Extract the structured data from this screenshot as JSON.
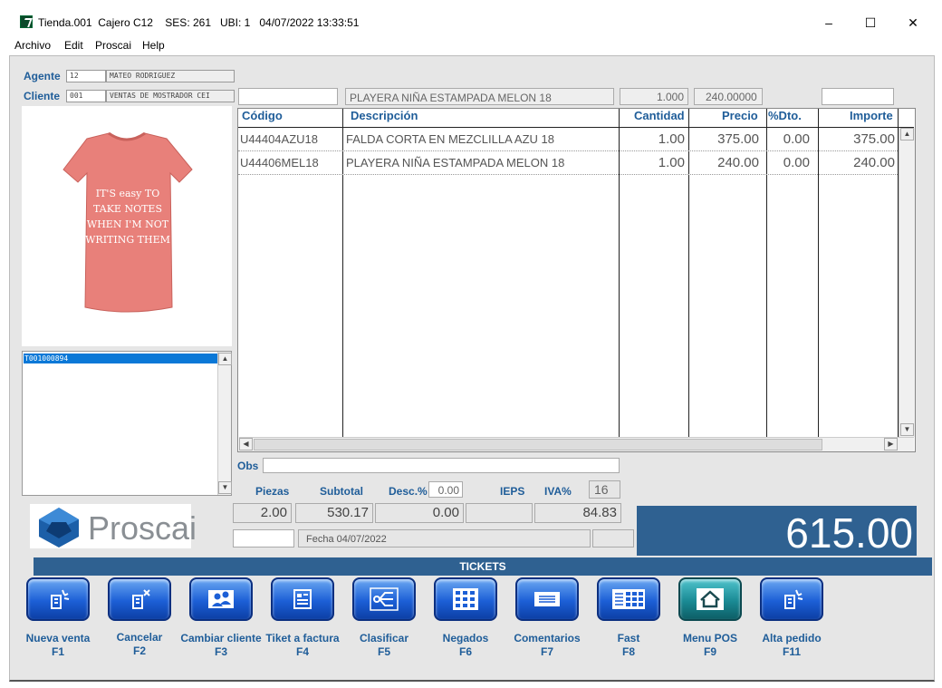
{
  "window": {
    "title": "Tienda.001  Cajero C12    SES: 261   UBI: 1   04/07/2022 13:33:51",
    "minimize": "–",
    "maximize": "☐",
    "close": "✕"
  },
  "menu": [
    "Archivo",
    "Edit",
    "Proscai",
    "Help"
  ],
  "agent": {
    "label": "Agente",
    "code": "12",
    "name": "MATEO RODRIGUEZ"
  },
  "client": {
    "label": "Cliente",
    "code": "001",
    "name": "VENTAS DE MOSTRADOR CEI"
  },
  "product_image": {
    "text_lines": [
      "IT'S easy TO",
      "TAKE NOTES",
      "WHEN I'M NOT",
      "WRITING THEM"
    ],
    "color": "#e8807a"
  },
  "ticket_list": {
    "selected": "T001000894"
  },
  "entry": {
    "code": "",
    "description": "PLAYERA NIÑA ESTAMPADA MELON 18",
    "quantity": "1.000",
    "price": "240.00000",
    "extra": ""
  },
  "table": {
    "headers": [
      "Código",
      "Descripción",
      "Cantidad",
      "Precio",
      "%Dto.",
      "Importe"
    ],
    "rows": [
      [
        "U44404AZU18",
        "FALDA CORTA EN MEZCLILLA AZU 18",
        "1.00",
        "375.00",
        "0.00",
        "375.00"
      ],
      [
        "U44406MEL18",
        "PLAYERA NIÑA ESTAMPADA MELON 18",
        "1.00",
        "240.00",
        "0.00",
        "240.00"
      ]
    ]
  },
  "obs": {
    "label": "Obs",
    "value": ""
  },
  "totals": {
    "piezas_label": "Piezas",
    "piezas": "2.00",
    "subtotal_label": "Subtotal",
    "subtotal": "530.17",
    "desc_label": "Desc.%",
    "desc_pct": "0.00",
    "desc": "0.00",
    "ieps_label": "IEPS",
    "ieps": "",
    "iva_label": "IVA%",
    "iva_pct": "16",
    "iva": "84.83",
    "total": "615.00"
  },
  "date_field": "Fecha 04/07/2022",
  "logo_text": "Proscai",
  "tickets_label": "TICKETS",
  "buttons": [
    {
      "label": "Nueva venta",
      "key": "F1",
      "icon": "new-sale-icon"
    },
    {
      "label": "Cancelar",
      "key": "F2",
      "icon": "cancel-icon"
    },
    {
      "label": "Cambiar cliente",
      "key": "F3",
      "icon": "users-icon"
    },
    {
      "label": "Tiket a factura",
      "key": "F4",
      "icon": "invoice-icon"
    },
    {
      "label": "Clasificar",
      "key": "F5",
      "icon": "classify-icon"
    },
    {
      "label": "Negados",
      "key": "F6",
      "icon": "grid-icon"
    },
    {
      "label": "Comentarios",
      "key": "F7",
      "icon": "comments-icon"
    },
    {
      "label": "Fast",
      "key": "F8",
      "icon": "fast-icon"
    },
    {
      "label": "Menu POS",
      "key": "F9",
      "icon": "home-icon"
    },
    {
      "label": "Alta pedido",
      "key": "F11",
      "icon": "new-order-icon"
    }
  ]
}
